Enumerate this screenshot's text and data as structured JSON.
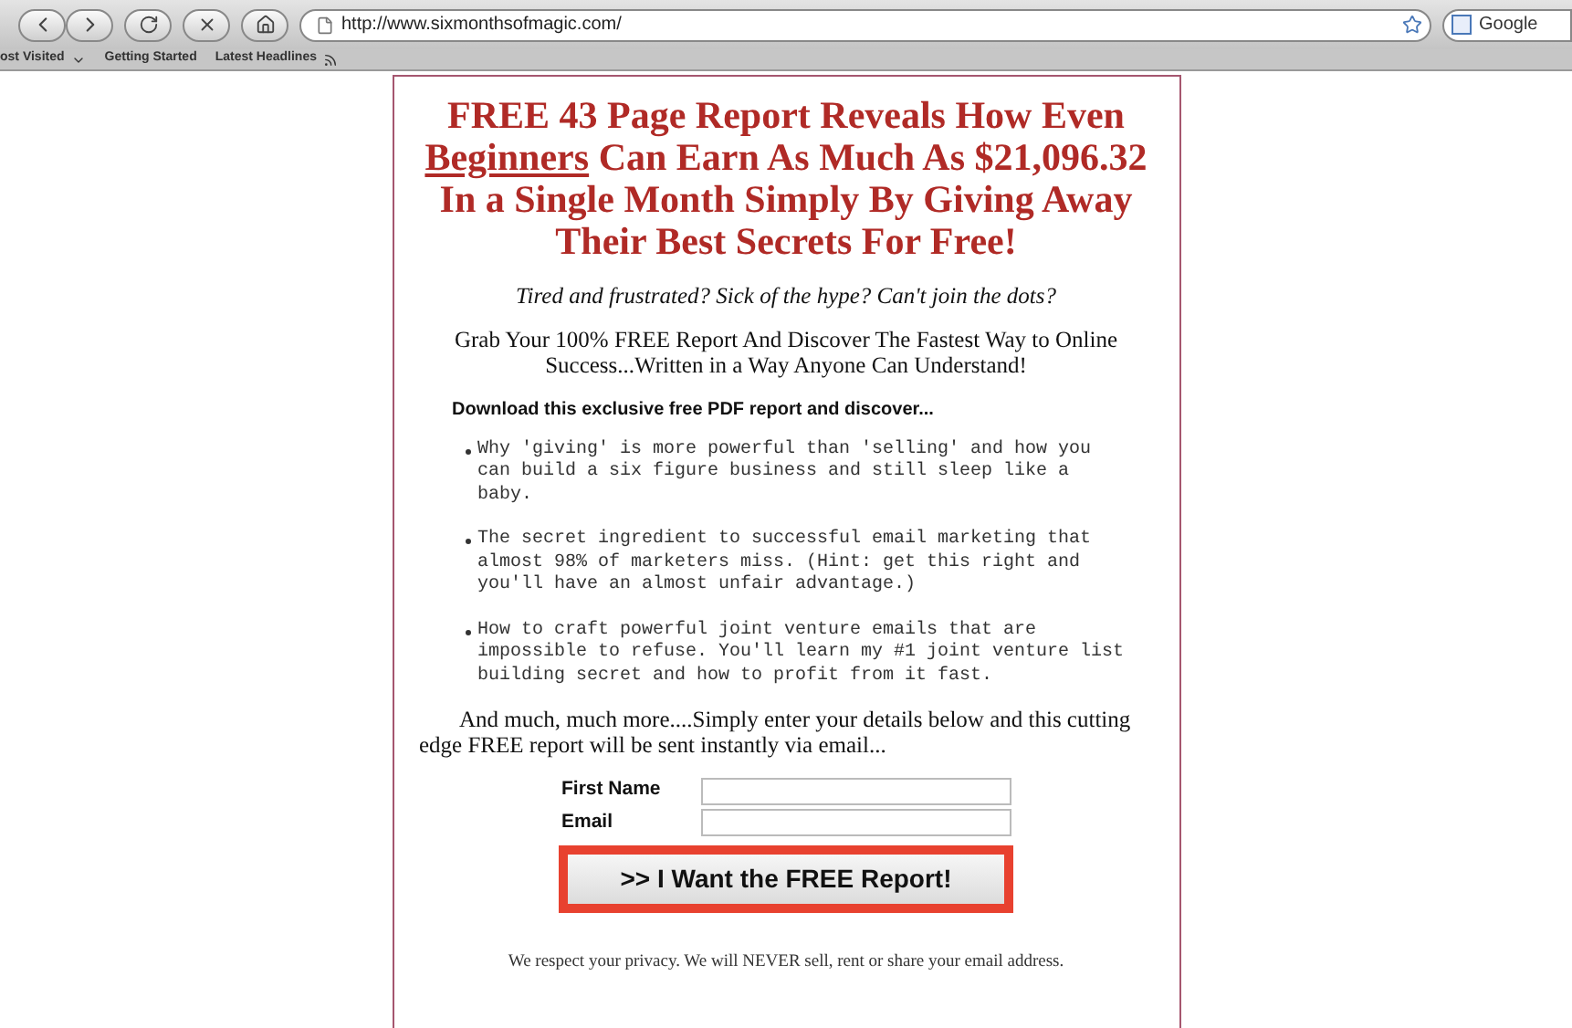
{
  "browser": {
    "url": "http://www.sixmonthsofmagic.com/",
    "search_placeholder": "Google"
  },
  "bookmarks": [
    {
      "label": "ost Visited",
      "kind": "menu"
    },
    {
      "label": "Getting Started",
      "kind": "link"
    },
    {
      "label": "Latest Headlines",
      "kind": "feed"
    }
  ],
  "page": {
    "headline": {
      "before": "FREE 43 Page Report Reveals How Even",
      "underlined": "Beginners",
      "after": "Can Earn As Much As $21,096.32 In a Single Month Simply By Giving Away Their Best Secrets For Free!"
    },
    "tagline": "Tired and frustrated? Sick of the hype? Can't join the dots?",
    "intro": "Grab Your 100% FREE Report And Discover The Fastest Way to Online Success...Written in a Way Anyone Can Understand!",
    "list_heading": "Download this exclusive free PDF report and discover...",
    "bullets": [
      "Why 'giving' is more powerful than 'selling' and how you can build a six figure business and still sleep like a baby.",
      "The secret ingredient to successful email marketing that almost 98% of marketers miss. (Hint: get this right and you'll have an almost unfair advantage.)",
      "How to craft powerful joint venture emails that are impossible to refuse. You'll learn my #1 joint venture list building secret and how to profit from it fast."
    ],
    "closing": "And much, much more....Simply enter your details below and this cutting edge FREE report will be sent instantly via email...",
    "form": {
      "fields": [
        {
          "label": "First Name"
        },
        {
          "label": "Email"
        }
      ],
      "button": ">> I Want the FREE Report!"
    },
    "privacy": "We respect your privacy. We will NEVER sell, rent or share your email address."
  }
}
